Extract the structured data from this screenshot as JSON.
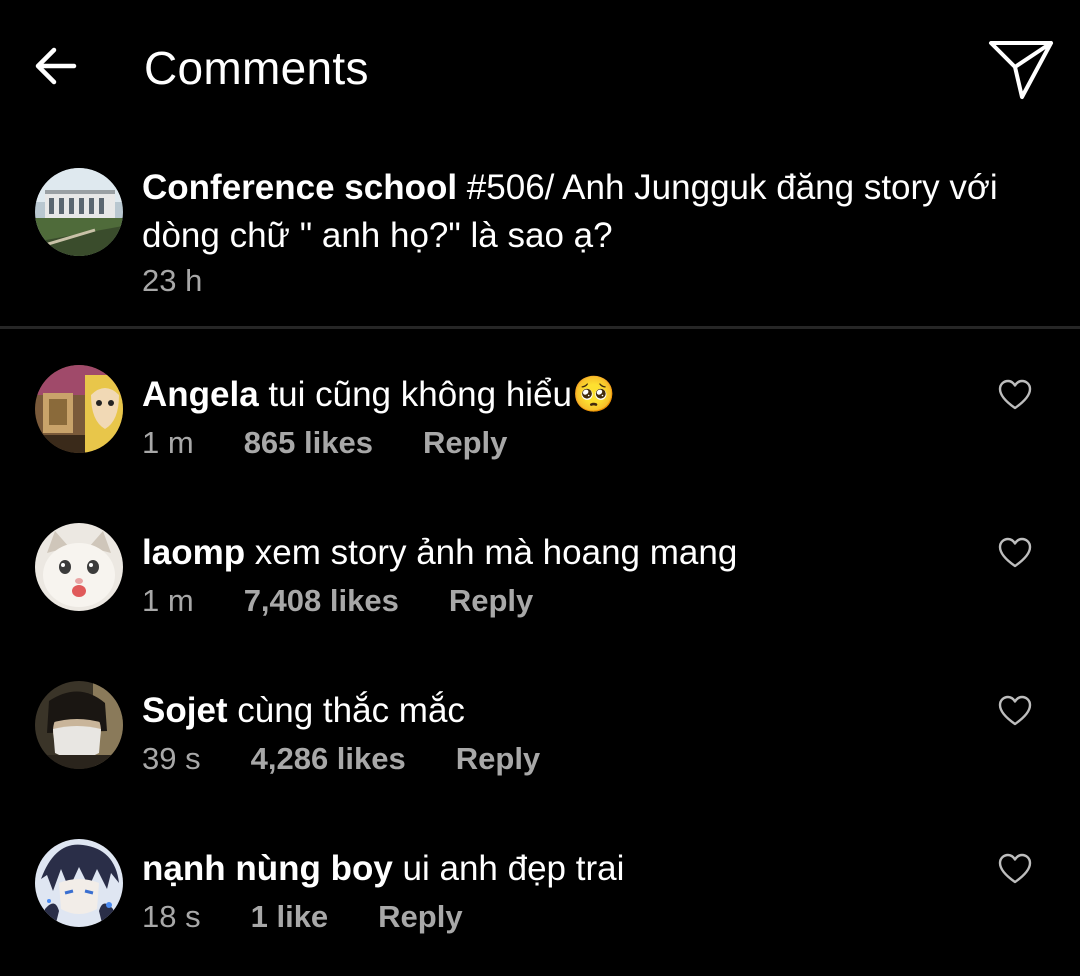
{
  "header": {
    "title": "Comments",
    "back_icon": "arrow-left-icon",
    "share_icon": "paper-plane-icon"
  },
  "caption": {
    "username": "Conference school",
    "text": " #506/ Anh Jungguk đăng story với",
    "text_line2": "dòng chữ \" anh họ?\" là sao ạ?",
    "time": "23 h"
  },
  "comments": [
    {
      "username": "Angela",
      "text": " tui cũng không hiểu🥺",
      "time": "1 m",
      "likes": "865 likes",
      "reply": "Reply"
    },
    {
      "username": "laomp",
      "text": " xem story ảnh mà hoang mang",
      "time": "1 m",
      "likes": "7,408 likes",
      "reply": "Reply"
    },
    {
      "username": "Sojet",
      "text": " cùng thắc mắc",
      "time": "39 s",
      "likes": "4,286 likes",
      "reply": "Reply"
    },
    {
      "username": "nạnh nùng boy",
      "text": " ui anh đẹp trai",
      "time": "18 s",
      "likes": "1 like",
      "reply": "Reply"
    }
  ],
  "colors": {
    "background": "#000000",
    "text": "#ffffff",
    "secondary_text": "#a8a8a8",
    "divider": "#262626"
  }
}
